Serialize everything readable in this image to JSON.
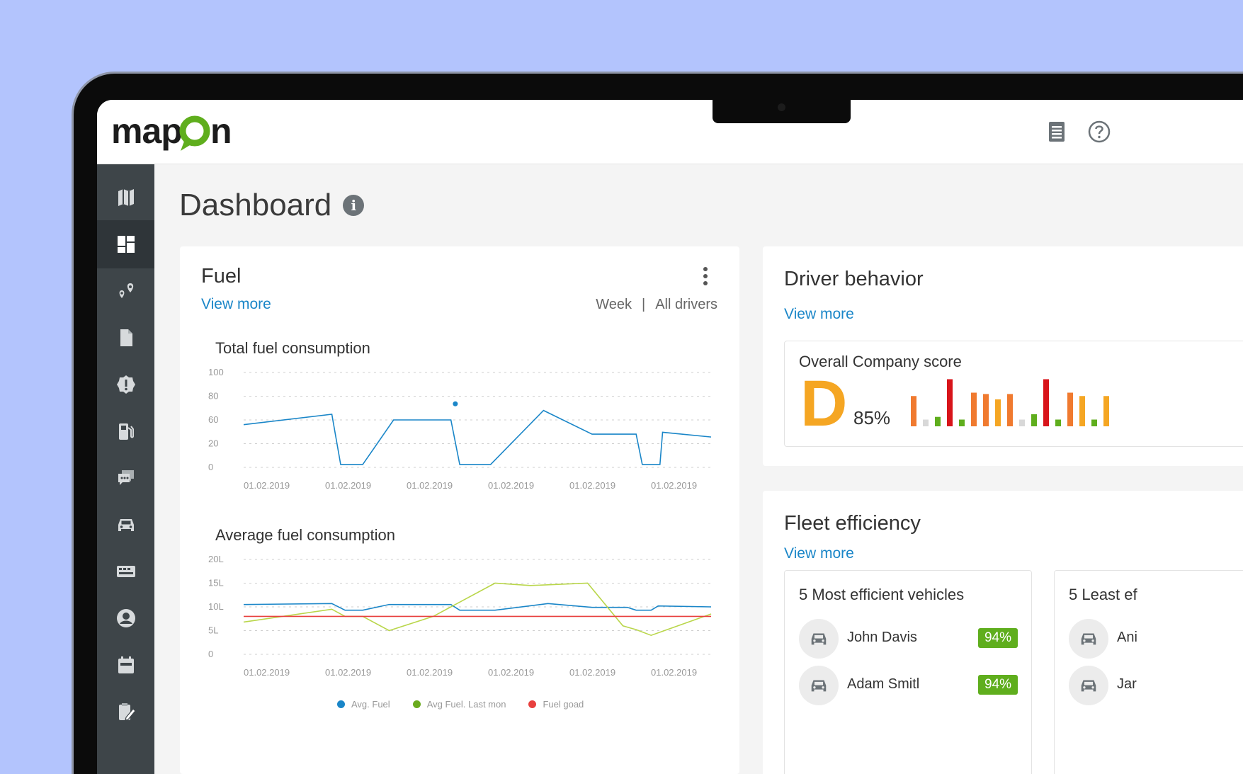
{
  "app": {
    "logo_text": "map",
    "logo_text_end": "n",
    "brand_color": "#5fae1d"
  },
  "page": {
    "title": "Dashboard"
  },
  "sidebar": {
    "items": [
      {
        "icon": "map-icon"
      },
      {
        "icon": "dashboard-icon",
        "active": true
      },
      {
        "icon": "route-pins-icon"
      },
      {
        "icon": "document-icon"
      },
      {
        "icon": "alert-badge-icon"
      },
      {
        "icon": "fuel-pump-icon"
      },
      {
        "icon": "chat-icon"
      },
      {
        "icon": "car-icon"
      },
      {
        "icon": "keyboard-icon"
      },
      {
        "icon": "user-icon"
      },
      {
        "icon": "calendar-icon"
      },
      {
        "icon": "clipboard-edit-icon"
      }
    ]
  },
  "fuel": {
    "title": "Fuel",
    "view_more": "View more",
    "period": "Week",
    "separator": "|",
    "drivers": "All drivers",
    "total_title": "Total fuel consumption",
    "avg_title": "Average fuel consumption",
    "legend": [
      {
        "label": "Avg. Fuel",
        "color": "#1a86c8"
      },
      {
        "label": "Avg Fuel. Last mon",
        "color": "#6aab1e"
      },
      {
        "label": "Fuel goad",
        "color": "#e8403e"
      }
    ]
  },
  "chart_data": [
    {
      "type": "line",
      "title": "Total fuel consumption",
      "y_ticks": [
        "100",
        "80",
        "60",
        "20",
        "0"
      ],
      "x_ticks": [
        "01.02.2019",
        "01.02.2019",
        "01.02.2019",
        "01.02.2019",
        "01.02.2019",
        "01.02.2019"
      ],
      "series": [
        {
          "color": "#1a86c8",
          "x": [
            0,
            1.0,
            1.1,
            1.35,
            1.7,
            2.35,
            2.45,
            2.8,
            3.4,
            3.95,
            4.05,
            4.45,
            4.52,
            4.72,
            4.75,
            5.3
          ],
          "y": [
            45,
            56,
            3,
            3,
            50,
            50,
            3,
            3,
            60,
            35,
            35,
            35,
            3,
            3,
            37,
            32
          ]
        }
      ],
      "points": [
        {
          "x": 2.4,
          "y": 67,
          "color": "#1a86c8"
        }
      ],
      "grid": true
    },
    {
      "type": "line",
      "title": "Average fuel consumption",
      "y_ticks": [
        "20L",
        "15L",
        "10L",
        "5L",
        "0"
      ],
      "x_ticks": [
        "01.02.2019",
        "01.02.2019",
        "01.02.2019",
        "01.02.2019",
        "01.02.2019",
        "01.02.2019"
      ],
      "series": [
        {
          "name": "Avg. Fuel",
          "color": "#1a86c8",
          "x": [
            0,
            1.0,
            1.15,
            1.35,
            1.65,
            2.35,
            2.45,
            2.85,
            3.45,
            3.95,
            4.35,
            4.45,
            4.62,
            4.7,
            5.3
          ],
          "y": [
            10.5,
            10.7,
            9.3,
            9.3,
            10.5,
            10.5,
            9.3,
            9.3,
            10.7,
            9.9,
            9.9,
            9.3,
            9.3,
            10.2,
            10
          ]
        },
        {
          "name": "Avg Fuel. Last mon",
          "color": "#b9d64a",
          "x": [
            0,
            1.0,
            1.15,
            1.35,
            1.65,
            2.15,
            2.85,
            3.25,
            3.9,
            4.3,
            4.45,
            4.62,
            5.3
          ],
          "y": [
            6.8,
            9.5,
            8,
            8,
            5,
            8,
            15,
            14.5,
            15,
            6,
            5.2,
            4,
            8.5
          ]
        },
        {
          "name": "Fuel goad",
          "color": "#e8403e",
          "x": [
            0,
            5.3
          ],
          "y": [
            8,
            8
          ]
        }
      ],
      "grid": true
    },
    {
      "type": "bar",
      "title": "Overall Company score",
      "values": [
        45,
        10,
        14,
        70,
        10,
        50,
        48,
        40,
        48,
        10,
        18,
        70,
        10,
        50,
        45,
        10,
        45
      ],
      "colors": [
        "#f07a2f",
        "#d8d8d8",
        "#5fae1d",
        "#d8141a",
        "#5fae1d",
        "#f07a2f",
        "#f07a2f",
        "#f5a623",
        "#f07a2f",
        "#d8d8d8",
        "#5fae1d",
        "#d8141a",
        "#5fae1d",
        "#f07a2f",
        "#f5a623",
        "#5fae1d",
        "#f5a623"
      ]
    }
  ],
  "driver": {
    "title": "Driver behavior",
    "view_more": "View more",
    "score_title": "Overall Company score",
    "grade": "D",
    "grade_color": "#f5a623",
    "percent": "85%"
  },
  "fleet": {
    "title": "Fleet efficiency",
    "view_more": "View more",
    "most_title": "5 Most efficient vehicles",
    "least_title": "5 Least ef",
    "most": [
      {
        "name": "John Davis",
        "score": "94%"
      },
      {
        "name": "Adam Smitl",
        "score": "94%"
      }
    ],
    "least": [
      {
        "name": "Ani"
      },
      {
        "name": "Jar"
      }
    ]
  }
}
